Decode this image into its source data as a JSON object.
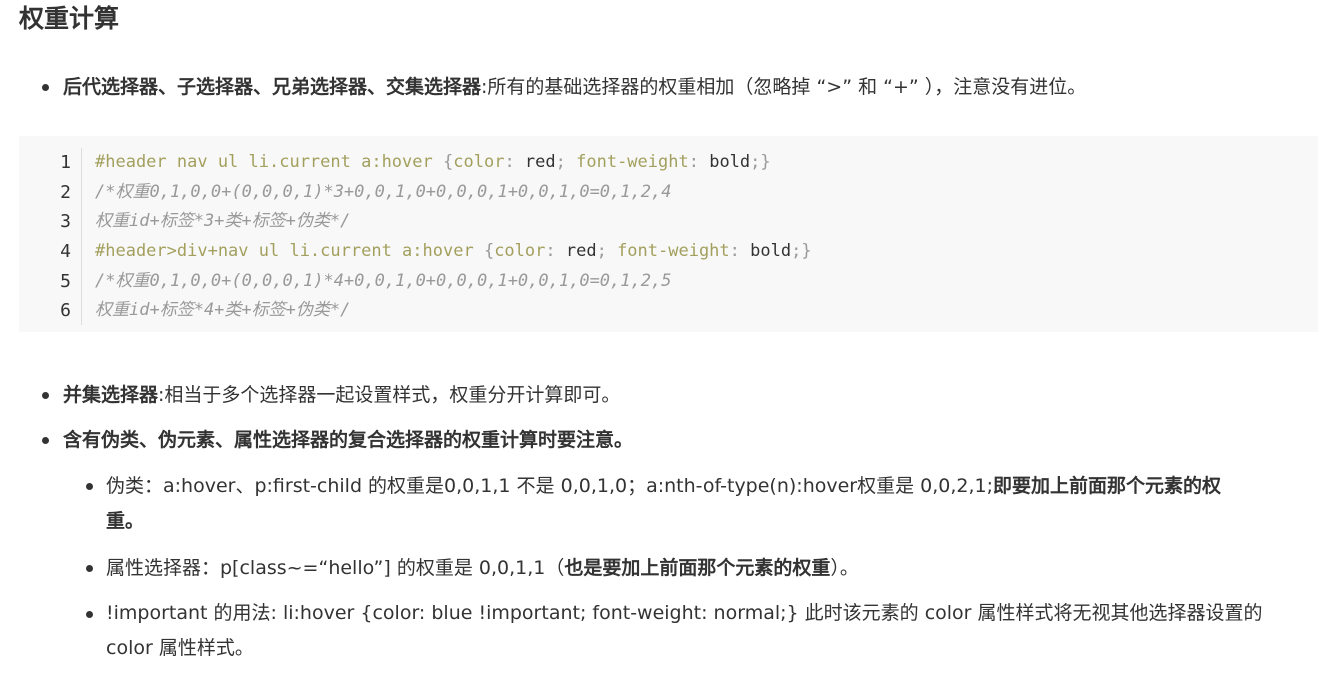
{
  "heading": "权重计算",
  "item1": {
    "bold": "后代选择器、子选择器、兄弟选择器、交集选择器",
    "rest": ":所有的基础选择器的权重相加（忽略掉 “>” 和 “+” ），注意没有进位。"
  },
  "code": {
    "line_numbers": [
      "1",
      "2",
      "3",
      "4",
      "5",
      "6"
    ],
    "line1": {
      "selector": "#header nav ul li.current a:hover ",
      "open": "{",
      "prop1": "color",
      "colon1": ": ",
      "val1": "red",
      "semi1": "; ",
      "prop2": "font-weight",
      "colon2": ": ",
      "val2": "bold",
      "close": ";}"
    },
    "line2": "/*权重0,1,0,0+(0,0,0,1)*3+0,0,1,0+0,0,0,1+0,0,1,0=0,1,2,4",
    "line3": "权重id+标签*3+类+标签+伪类*/",
    "line4": {
      "selector": "#header>div+nav ul li.current a:hover ",
      "open": "{",
      "prop1": "color",
      "colon1": ": ",
      "val1": "red",
      "semi1": "; ",
      "prop2": "font-weight",
      "colon2": ": ",
      "val2": "bold",
      "close": ";}"
    },
    "line5": "/*权重0,1,0,0+(0,0,0,1)*4+0,0,1,0+0,0,0,1+0,0,1,0=0,1,2,5",
    "line6": "权重id+标签*4+类+标签+伪类*/"
  },
  "item2": {
    "bold": "并集选择器",
    "rest": ":相当于多个选择器一起设置样式，权重分开计算即可。"
  },
  "item3": {
    "bold": "含有伪类、伪元素、属性选择器的复合选择器的权重计算时要注意。"
  },
  "sub1": {
    "text": "伪类：a:hover、p:first-child 的权重是0,0,1,1 不是 0,0,1,0；a:nth-of-type(n):hover权重是 0,0,2,1;",
    "bold_a": "即要加上前面那个元素的权",
    "bold_b": "重。"
  },
  "sub2": {
    "text": "属性选择器：p[class~=“hello”] 的权重是 0,0,1,1（",
    "bold": "也是要加上前面那个元素的权重",
    "tail": "）。"
  },
  "sub3": {
    "line_a": "!important 的用法: li:hover {color: blue !important; font-weight: normal;} 此时该元素的 color 属性样式将无视其他选择器设置的",
    "line_b": "color 属性样式。"
  },
  "colors": {
    "text": "#333333",
    "code_bg": "#f8f8f8",
    "selector": "#a3a05e",
    "comment": "#999999"
  }
}
